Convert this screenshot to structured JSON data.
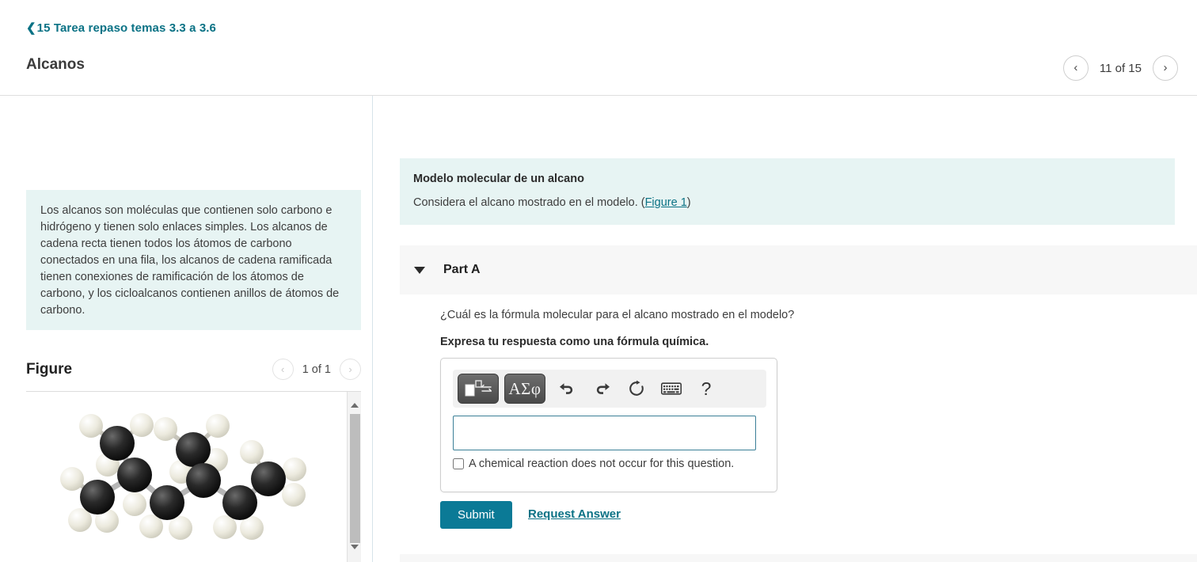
{
  "header": {
    "breadcrumb_chevron": "chevron-left-icon",
    "breadcrumb": "15 Tarea repaso temas 3.3 a 3.6",
    "title": "Alcanos",
    "prev_icon": "‹",
    "next_icon": "›",
    "counter": "11 of 15"
  },
  "sidebar": {
    "intro": "Los alcanos son moléculas que contienen solo carbono e hidrógeno y tienen solo enlaces simples. Los alcanos de cadena recta tienen todos los átomos de carbono conectados en una fila, los alcanos de cadena ramificada tienen conexiones de ramificación de los átomos de carbono, y los cicloalcanos contienen anillos de átomos de carbono.",
    "figure_title": "Figure",
    "figure_counter": "1 of 1",
    "figure_prev_icon": "‹",
    "figure_next_icon": "›",
    "figure_alt": "Modelo de bolas y varillas de un alcano ramificado con 8 átomos de carbono (negros) y átomos de hidrógeno (blancos)"
  },
  "question": {
    "title": "Modelo molecular de un alcano",
    "text_before_link": "Considera el alcano mostrado en el modelo. (",
    "link": "Figure 1",
    "text_after_link": ")"
  },
  "part": {
    "label": "Part A",
    "caret_icon": "caret-down-icon",
    "prompt": "¿Cuál es la fórmula molecular para el alcano mostrado en el modelo?",
    "instruction": "Expresa tu respuesta como una fórmula química."
  },
  "answer": {
    "toolbar": {
      "template_button": "chem-template-icon",
      "greek_button": "ΑΣφ",
      "undo_icon": "undo-arrow-icon",
      "redo_icon": "redo-arrow-icon",
      "reset_icon": "reset-circular-arrow-icon",
      "keyboard_icon": "keyboard-icon",
      "help_icon": "?"
    },
    "input_value": "",
    "input_placeholder": "",
    "checkbox_label": "A chemical reaction does not occur for this question.",
    "checkbox_checked": false
  },
  "actions": {
    "submit": "Submit",
    "request_answer": "Request Answer"
  },
  "colors": {
    "accent": "#0b7285",
    "submit_bg": "#0b7a96",
    "info_bg": "#e7f4f3",
    "part_bg": "#f7f7f7",
    "input_border": "#3b7f97"
  }
}
